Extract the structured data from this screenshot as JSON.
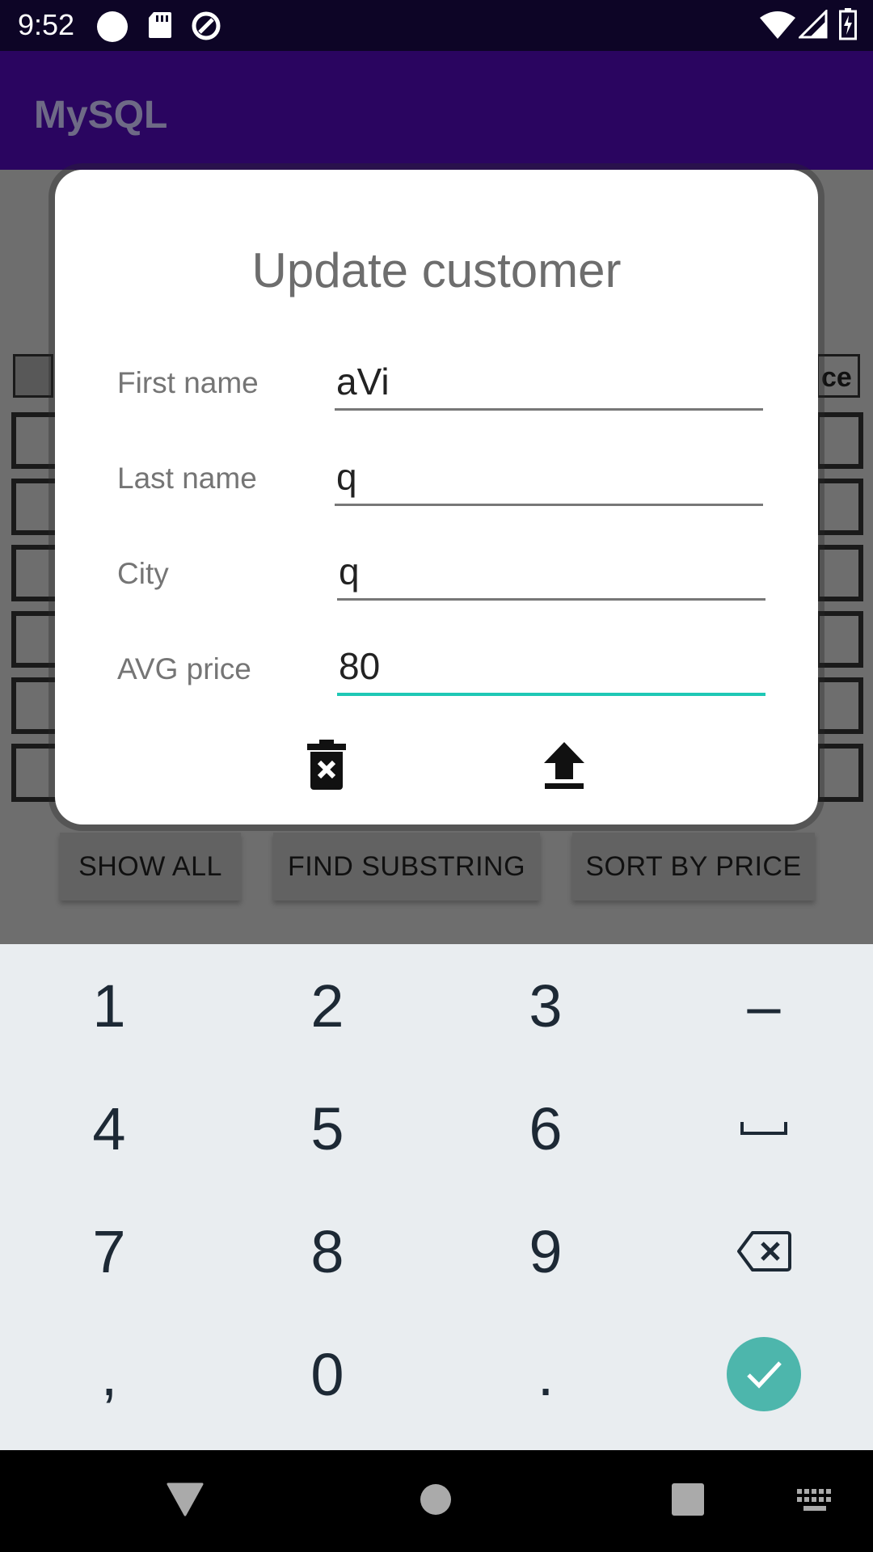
{
  "status_bar": {
    "time": "9:52",
    "icons": [
      "circle-icon",
      "sd-card-icon",
      "data-saver-icon",
      "wifi-icon",
      "signal-icon",
      "battery-charging-icon"
    ]
  },
  "app_bar": {
    "title": "MySQL"
  },
  "background": {
    "header_right_text": "ce",
    "buttons": {
      "show_all": "SHOW ALL",
      "find_substring": "FIND SUBSTRING",
      "sort_by_price": "SORT BY PRICE"
    }
  },
  "dialog": {
    "title": "Update customer",
    "fields": {
      "first_name": {
        "label": "First name",
        "value": "aVi"
      },
      "last_name": {
        "label": "Last name",
        "value": "q"
      },
      "city": {
        "label": "City",
        "value": "q"
      },
      "avg_price": {
        "label": "AVG price",
        "value": "80"
      }
    },
    "actions": [
      "delete-icon",
      "upload-icon"
    ]
  },
  "keyboard": {
    "keys": {
      "k1": "1",
      "k2": "2",
      "k3": "3",
      "minus": "–",
      "k4": "4",
      "k5": "5",
      "k6": "6",
      "k7": "7",
      "k8": "8",
      "k9": "9",
      "comma": ",",
      "k0": "0",
      "period": "."
    },
    "special": [
      "space-icon",
      "backspace-icon",
      "check-icon"
    ],
    "accent_color": "#4db6ac"
  },
  "nav_bar": {
    "icons": [
      "back-icon",
      "home-icon",
      "recents-icon",
      "keyboard-icon"
    ]
  },
  "colors": {
    "app_bar": "#2a0560",
    "status_bar": "#0d0526",
    "input_active": "#1ec8b5"
  }
}
